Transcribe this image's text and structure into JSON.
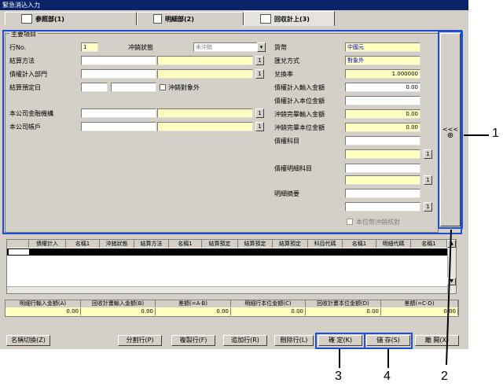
{
  "window": {
    "title": "緊急消込入力"
  },
  "tabs": [
    {
      "label": "参照部(1)"
    },
    {
      "label": "明細部(2)"
    },
    {
      "label": "回収計上(3)"
    }
  ],
  "main": {
    "group_title": "主要項目",
    "row_no": {
      "label": "行No.",
      "value": "1"
    },
    "offset_status": {
      "label": "冲銷狀態",
      "value": "未沖銷"
    },
    "settle_method": {
      "label": "結算方法",
      "btn": "1"
    },
    "debt_dept": {
      "label": "債權計入部門",
      "btn": "1"
    },
    "settle_date": {
      "label": "結算預定日",
      "check_label": "沖銷對象外"
    },
    "company_bank": {
      "label": "本公司金融機構",
      "btn": "1"
    },
    "company_account": {
      "label": "本公司帳戶",
      "btn": "1"
    },
    "currency": {
      "label": "貨幣",
      "value": "中國元"
    },
    "exchange_method": {
      "label": "匯兌方式",
      "value": "對象外"
    },
    "rate": {
      "label": "兌換率",
      "value": "1.000000"
    },
    "debt_input_amount": {
      "label": "債權計入輸入金額",
      "value": "0.00"
    },
    "debt_local_amount": {
      "label": "債權計入本位金額",
      "value": ""
    },
    "offset_input_amount": {
      "label": "沖銷完畢輸入金額",
      "value": "0.00"
    },
    "offset_local_amount": {
      "label": "沖銷完畢本位金額",
      "value": "0.00"
    },
    "debt_subject": {
      "label": "債權科目",
      "btn": "1"
    },
    "debt_detail": {
      "label": "債權明細科目",
      "btn": "1"
    },
    "summary": {
      "label": "明細摘要",
      "btn": "1"
    },
    "local_check": {
      "label": "本位幣沖銷核對"
    },
    "side_button": {
      "label": "<<<",
      "sub": "⊕"
    }
  },
  "grid": {
    "columns": [
      "債權計入",
      "名稱1",
      "沖銷狀態",
      "結算方法",
      "名稱1",
      "結算預定",
      "結算預定",
      "結算預定",
      "科目代碼",
      "名稱1",
      "明細代碼",
      "名稱1"
    ]
  },
  "footer": {
    "columns": [
      "明細行輸入金額(A)",
      "回收計畫輸入金額(B)",
      "差額(=A-B)",
      "明細行本位金額(C)",
      "回收計畫本位金額(D)",
      "差額(=C-D)"
    ],
    "values": [
      "0.00",
      "0.00",
      "0.00",
      "0.00",
      "0.00",
      "0.00"
    ]
  },
  "toolbar": {
    "name_switch": "名稱切換(Z)",
    "split_row": "分割行(P)",
    "copy_row": "複製行(F)",
    "add_row": "追加行(R)",
    "delete_row": "刪除行(L)",
    "confirm": "確 定(K)",
    "save": "儲 存(S)",
    "close": "離 開(X)"
  },
  "callouts": {
    "n1": "1",
    "n2": "2",
    "n3": "3",
    "n4": "4"
  }
}
